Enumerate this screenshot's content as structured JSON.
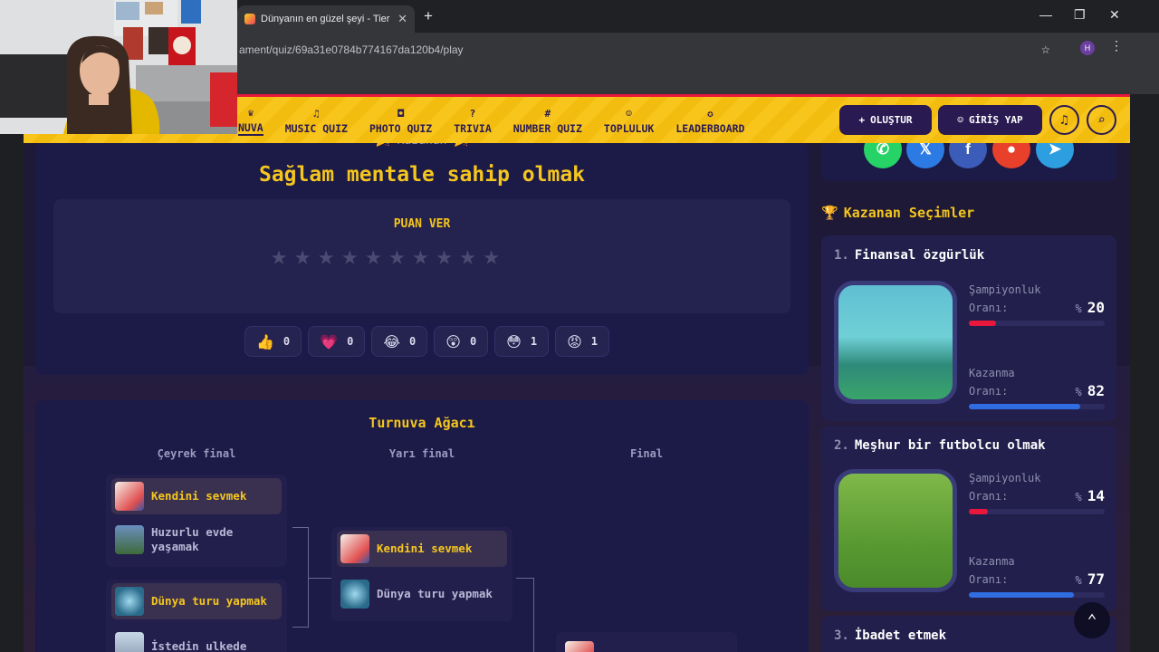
{
  "browser": {
    "tab_title": "Dünyanın en güzel şeyi - Tier Li",
    "url": "ament/quiz/69a31e0784b774167da120b4/play",
    "profile_initial": "H"
  },
  "nav": {
    "items": [
      {
        "icon": "trophy-icon",
        "glyph": "♛",
        "label": "NUVA"
      },
      {
        "icon": "music-note-icon",
        "glyph": "♫",
        "label": "MUSIC QUIZ"
      },
      {
        "icon": "camera-icon",
        "glyph": "◘",
        "label": "PHOTO QUIZ"
      },
      {
        "icon": "question-circle-icon",
        "glyph": "?",
        "label": "TRIVIA"
      },
      {
        "icon": "hash-icon",
        "glyph": "#",
        "label": "NUMBER QUIZ"
      },
      {
        "icon": "users-icon",
        "glyph": "☺",
        "label": "TOPLULUK"
      },
      {
        "icon": "medal-icon",
        "glyph": "✪",
        "label": "LEADERBOARD"
      }
    ],
    "create_label": "OLUŞTUR",
    "login_label": "GİRİŞ YAP"
  },
  "winner": {
    "tag": "🎉 Kazanan 🎉",
    "title": "Sağlam mentale sahip olmak",
    "rate_label": "PUAN VER",
    "star_count": 10,
    "reactions": [
      {
        "icon": "thumbs-up-icon",
        "emoji": "👍",
        "count": "0"
      },
      {
        "icon": "heart-icon",
        "emoji": "💗",
        "count": "0"
      },
      {
        "icon": "laugh-icon",
        "emoji": "😂",
        "count": "0"
      },
      {
        "icon": "wow-icon",
        "emoji": "😲",
        "count": "0"
      },
      {
        "icon": "flushed-icon",
        "emoji": "😳",
        "count": "1"
      },
      {
        "icon": "angry-icon",
        "emoji": "😡",
        "count": "1"
      }
    ]
  },
  "bracket": {
    "title": "Turnuva Ağacı",
    "rounds": [
      "Çeyrek final",
      "Yarı final",
      "Final"
    ],
    "qf1": {
      "winner": "Kendini sevmek",
      "loser": "Huzurlu evde yaşamak"
    },
    "qf2": {
      "winner": "Dünya turu yapmak",
      "loser": "İstedin ulkede"
    },
    "sf1": {
      "winner": "Kendini sevmek",
      "loser": "Dünya turu yapmak"
    }
  },
  "sidebar": {
    "title": "Kazanan Seçimler",
    "champ_label_1": "Şampiyonluk",
    "champ_label_2": "Oranı:",
    "win_label_1": "Kazanma",
    "win_label_2": "Oranı:",
    "percent_sign": "%",
    "ranks": [
      {
        "num": "1.",
        "name": "Finansal özgürlük",
        "champ": "20",
        "win": "82"
      },
      {
        "num": "2.",
        "name": "Meşhur bir futbolcu olmak",
        "champ": "14",
        "win": "77"
      },
      {
        "num": "3.",
        "name": "İbadet etmek"
      }
    ]
  },
  "colors": {
    "accent": "#f5c61e",
    "navy": "#2a1a52",
    "red_bar": "#e8173b",
    "blue_bar": "#2f6de1"
  }
}
